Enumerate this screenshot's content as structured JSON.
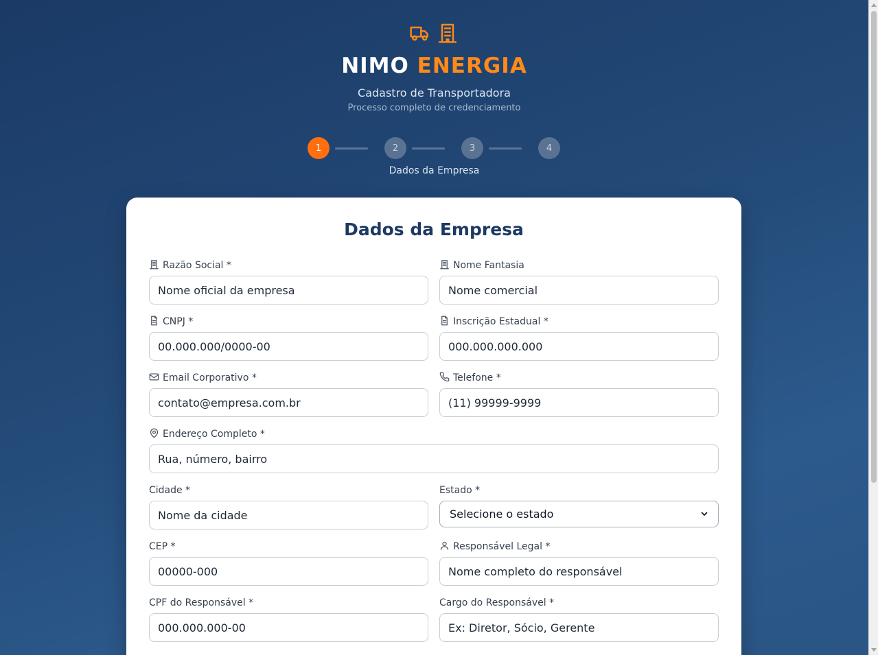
{
  "brand": {
    "name_part1": "NIMO",
    "name_part2": "ENERGIA",
    "accent_color": "#ff8a1a"
  },
  "header": {
    "subtitle": "Cadastro de Transportadora",
    "description": "Processo completo de credenciamento",
    "icons": [
      "truck-icon",
      "building-icon"
    ]
  },
  "stepper": {
    "steps": [
      "1",
      "2",
      "3",
      "4"
    ],
    "active_step": 1,
    "current_label": "Dados da Empresa",
    "active_color": "#ff6f0f"
  },
  "form": {
    "title": "Dados da Empresa",
    "fields": {
      "razao_social": {
        "label": "Razão Social *",
        "placeholder": "Nome oficial da empresa",
        "icon": "building-icon"
      },
      "nome_fantasia": {
        "label": "Nome Fantasia",
        "placeholder": "Nome comercial",
        "icon": "building-icon"
      },
      "cnpj": {
        "label": "CNPJ *",
        "placeholder": "00.000.000/0000-00",
        "icon": "document-icon"
      },
      "inscricao_estadual": {
        "label": "Inscrição Estadual *",
        "placeholder": "000.000.000.000",
        "icon": "document-icon"
      },
      "email": {
        "label": "Email Corporativo *",
        "placeholder": "contato@empresa.com.br",
        "icon": "mail-icon"
      },
      "telefone": {
        "label": "Telefone *",
        "placeholder": "(11) 99999-9999",
        "icon": "phone-icon"
      },
      "endereco": {
        "label": "Endereço Completo *",
        "placeholder": "Rua, número, bairro",
        "icon": "map-pin-icon"
      },
      "cidade": {
        "label": "Cidade *",
        "placeholder": "Nome da cidade"
      },
      "estado": {
        "label": "Estado *",
        "selected": "Selecione o estado"
      },
      "cep": {
        "label": "CEP *",
        "placeholder": "00000-000"
      },
      "responsavel": {
        "label": "Responsável Legal *",
        "placeholder": "Nome completo do responsável",
        "icon": "user-icon"
      },
      "cpf_responsavel": {
        "label": "CPF do Responsável *",
        "placeholder": "000.000.000-00"
      },
      "cargo_responsavel": {
        "label": "Cargo do Responsável *",
        "placeholder": "Ex: Diretor, Sócio, Gerente"
      }
    }
  }
}
